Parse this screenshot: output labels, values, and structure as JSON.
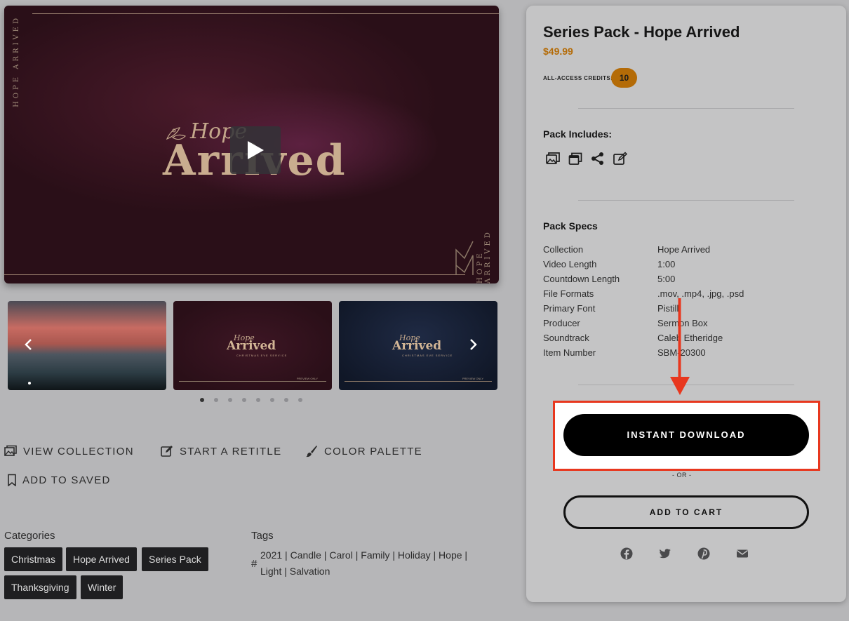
{
  "video": {
    "side_text": "HOPE ARRIVED",
    "title_script": "Hope",
    "title_main": "Arrived"
  },
  "thumbnails": [
    {
      "kind": "landscape"
    },
    {
      "kind": "title-red",
      "script": "Hope",
      "main": "Arrived",
      "sub": "CHRISTMAS EVE SERVICE",
      "preview": "PREVIEW ONLY"
    },
    {
      "kind": "title-blue",
      "script": "Hope",
      "main": "Arrived",
      "sub": "CHRISTMAS EVE SERVICE",
      "preview": "PREVIEW ONLY"
    }
  ],
  "carousel": {
    "dot_count": 8,
    "active_index": 0
  },
  "actions": {
    "view_collection": "VIEW COLLECTION",
    "start_retitle": "START A RETITLE",
    "color_palette": "COLOR PALETTE",
    "add_to_saved": "ADD TO SAVED"
  },
  "categories": {
    "label": "Categories",
    "items": [
      "Christmas",
      "Hope Arrived",
      "Series Pack",
      "Thanksgiving",
      "Winter"
    ]
  },
  "tags": {
    "label": "Tags",
    "hash": "#",
    "line1": [
      "2021",
      "Candle",
      "Carol",
      "Family",
      "Holiday",
      "Hope"
    ],
    "line2": [
      "Light",
      "Salvation"
    ],
    "separator": " | "
  },
  "product": {
    "title": "Series Pack - Hope Arrived",
    "price": "$49.99",
    "credits_label": "ALL-ACCESS CREDITS:",
    "credits_value": "10",
    "includes_heading": "Pack Includes:",
    "include_icons": [
      "images-icon",
      "layers-icon",
      "share-icon",
      "edit-icon"
    ],
    "specs_heading": "Pack Specs",
    "specs": [
      {
        "key": "Collection",
        "value": "Hope Arrived"
      },
      {
        "key": "Video Length",
        "value": "1:00"
      },
      {
        "key": "Countdown Length",
        "value": "5:00"
      },
      {
        "key": "File Formats",
        "value": ".mov, .mp4, .jpg, .psd"
      },
      {
        "key": "Primary Font",
        "value": "Pistilli"
      },
      {
        "key": "Producer",
        "value": "Sermon Box"
      },
      {
        "key": "Soundtrack",
        "value": "Caleb Etheridge"
      },
      {
        "key": "Item Number",
        "value": "SBM-20300"
      }
    ],
    "download_label": "INSTANT DOWNLOAD",
    "or_text": "- OR -",
    "cart_label": "ADD TO CART",
    "share_icons": [
      "facebook-icon",
      "twitter-icon",
      "pinterest-icon",
      "email-icon"
    ]
  },
  "colors": {
    "accent": "#b46b07",
    "annotation": "#e8371e",
    "button": "#000000"
  }
}
